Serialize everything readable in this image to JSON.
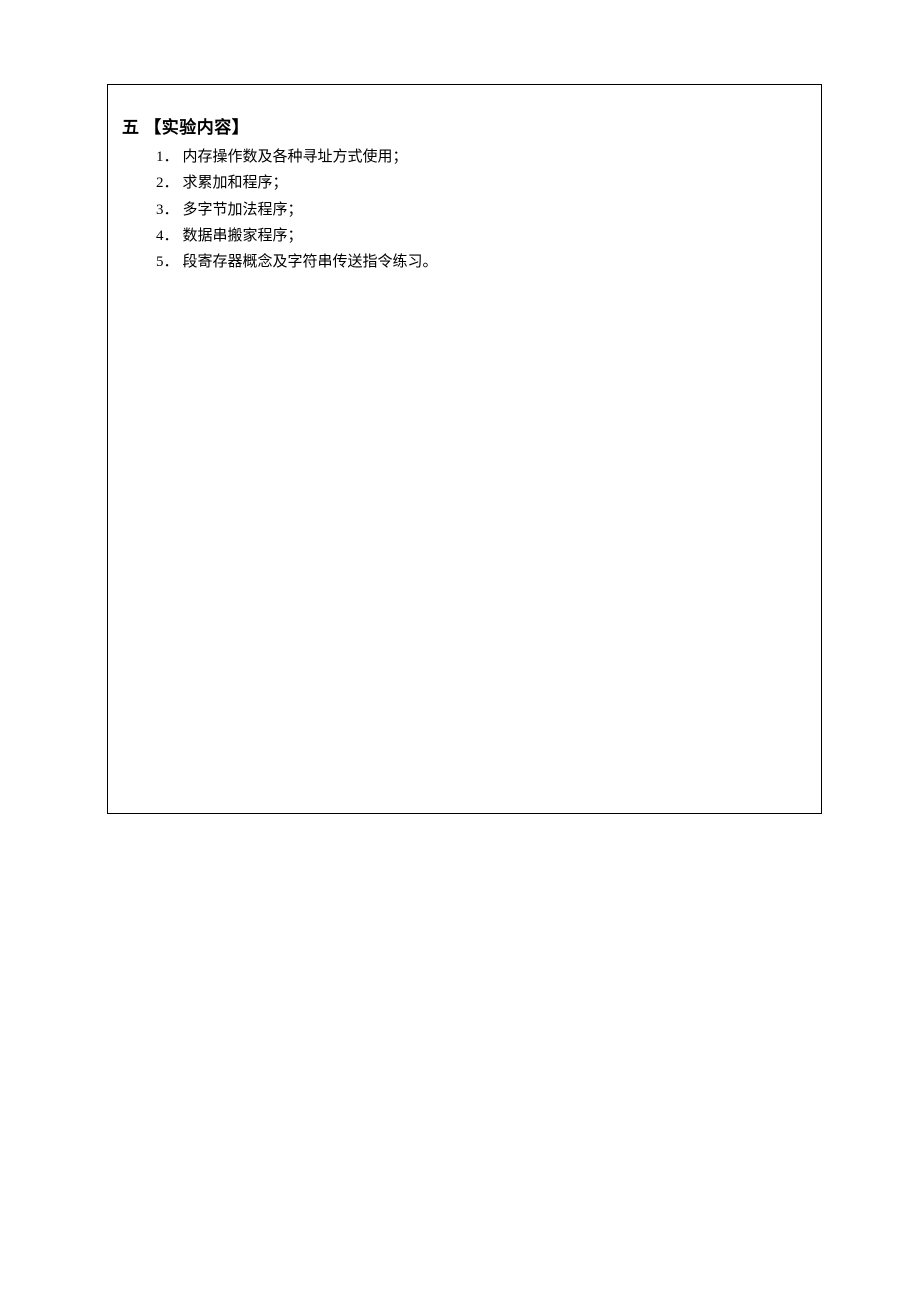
{
  "heading": {
    "prefix": "五",
    "title": "【实验内容】"
  },
  "items": [
    {
      "number": "1．",
      "text": "内存操作数及各种寻址方式使用；"
    },
    {
      "number": "2．",
      "text": "求累加和程序；"
    },
    {
      "number": "3．",
      "text": "多字节加法程序；"
    },
    {
      "number": "4．",
      "text": "数据串搬家程序；"
    },
    {
      "number": "5．",
      "text": "段寄存器概念及字符串传送指令练习。"
    }
  ]
}
